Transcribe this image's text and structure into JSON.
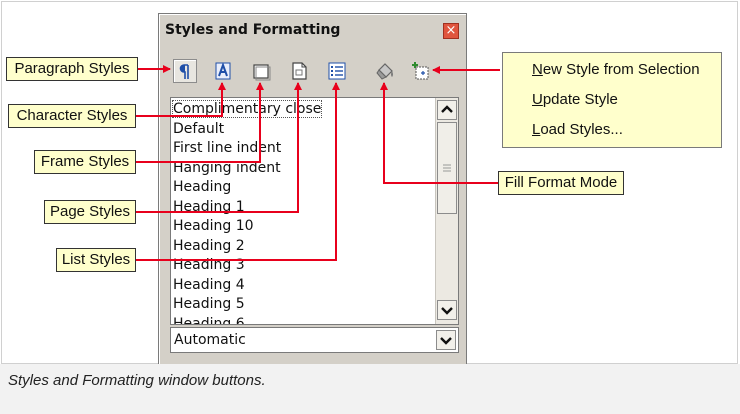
{
  "window": {
    "title": "Styles and Formatting",
    "close_glyph": "×",
    "toolbar": [
      {
        "name": "paragraph-styles-icon",
        "active": true
      },
      {
        "name": "character-styles-icon",
        "active": false
      },
      {
        "name": "frame-styles-icon",
        "active": false
      },
      {
        "name": "page-styles-icon",
        "active": false
      },
      {
        "name": "list-styles-icon",
        "active": false
      },
      {
        "name": "fill-format-mode-icon",
        "active": false
      },
      {
        "name": "new-style-menu-icon",
        "active": false
      }
    ],
    "style_list": [
      "Complimentary close",
      "Default",
      "First line indent",
      "Hanging indent",
      "Heading",
      "Heading 1",
      "Heading 10",
      "Heading 2",
      "Heading 3",
      "Heading 4",
      "Heading 5",
      "Heading 6"
    ],
    "selected_style": "Complimentary close",
    "filter_value": "Automatic"
  },
  "callouts": {
    "paragraph_styles": "Paragraph Styles",
    "character_styles": "Character Styles",
    "frame_styles": "Frame Styles",
    "page_styles": "Page Styles",
    "list_styles": "List Styles",
    "fill_format_mode": "Fill Format Mode"
  },
  "new_style_menu": {
    "items": [
      {
        "mnemonic": "N",
        "rest": "ew Style from Selection"
      },
      {
        "mnemonic": "U",
        "rest": "pdate Style"
      },
      {
        "mnemonic": "L",
        "rest": "oad Styles..."
      }
    ]
  },
  "caption": "Styles and Formatting window buttons.",
  "colors": {
    "arrow": "#e8001c",
    "callout_bg": "#ffffcc",
    "window_bg": "#d4d0c8",
    "close_btn": "#e0553e",
    "icon_blue": "#1f4fa8"
  }
}
